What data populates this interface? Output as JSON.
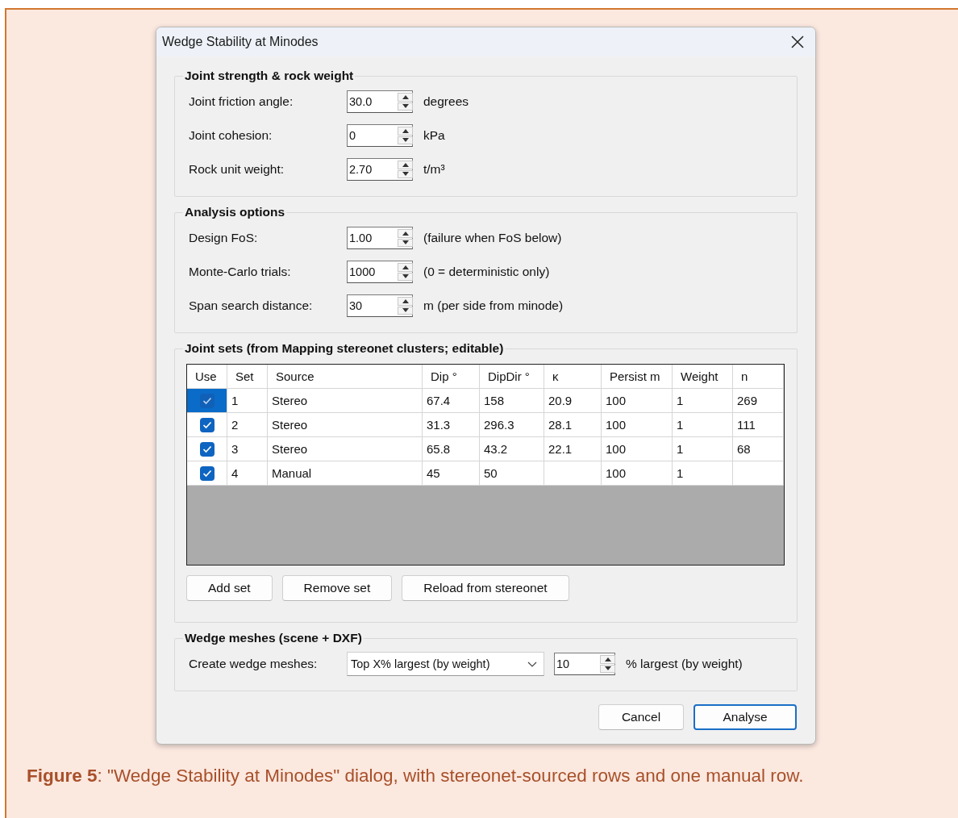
{
  "dialog": {
    "title": "Wedge Stability at Minodes"
  },
  "strength": {
    "title": "Joint strength & rock weight",
    "fields": [
      {
        "label": "Joint friction angle:",
        "value": "30.0",
        "unit": "degrees"
      },
      {
        "label": "Joint cohesion:",
        "value": "0",
        "unit": "kPa"
      },
      {
        "label": "Rock unit weight:",
        "value": "2.70",
        "unit": "t/m³"
      }
    ]
  },
  "analysis": {
    "title": "Analysis options",
    "fields": [
      {
        "label": "Design FoS:",
        "value": "1.00",
        "unit": "(failure when FoS below)"
      },
      {
        "label": "Monte-Carlo trials:",
        "value": "1000",
        "unit": "(0 = deterministic only)"
      },
      {
        "label": "Span search distance:",
        "value": "30",
        "unit": "m (per side from minode)"
      }
    ]
  },
  "joint_sets": {
    "title": "Joint sets (from Mapping stereonet clusters; editable)",
    "columns": [
      "Use",
      "Set",
      "Source",
      "Dip °",
      "DipDir °",
      "κ",
      "Persist m",
      "Weight",
      "n"
    ],
    "rows": [
      {
        "selected": true,
        "checked": true,
        "cells": [
          "",
          "1",
          "Stereo",
          "67.4",
          "158",
          "20.9",
          "100",
          "1",
          "269"
        ]
      },
      {
        "selected": false,
        "checked": true,
        "cells": [
          "",
          "2",
          "Stereo",
          "31.3",
          "296.3",
          "28.1",
          "100",
          "1",
          "111"
        ]
      },
      {
        "selected": false,
        "checked": true,
        "cells": [
          "",
          "3",
          "Stereo",
          "65.8",
          "43.2",
          "22.1",
          "100",
          "1",
          "68"
        ]
      },
      {
        "selected": false,
        "checked": true,
        "cells": [
          "",
          "4",
          "Manual",
          "45",
          "50",
          "",
          "100",
          "1",
          ""
        ]
      }
    ],
    "buttons": [
      "Add set",
      "Remove set",
      "Reload from stereonet"
    ]
  },
  "wedge_meshes": {
    "title": "Wedge meshes (scene + DXF)",
    "label": "Create wedge meshes:",
    "dropdown": "Top X% largest (by weight)",
    "value": "10",
    "unit": "% largest (by weight)"
  },
  "buttons": [
    {
      "label": "Cancel",
      "default": false
    },
    {
      "label": "Analyse",
      "default": true
    }
  ],
  "caption": "**Figure 5**: \"Wedge Stability at Minodes\" dialog, with stereonet-sourced rows and one manual row."
}
